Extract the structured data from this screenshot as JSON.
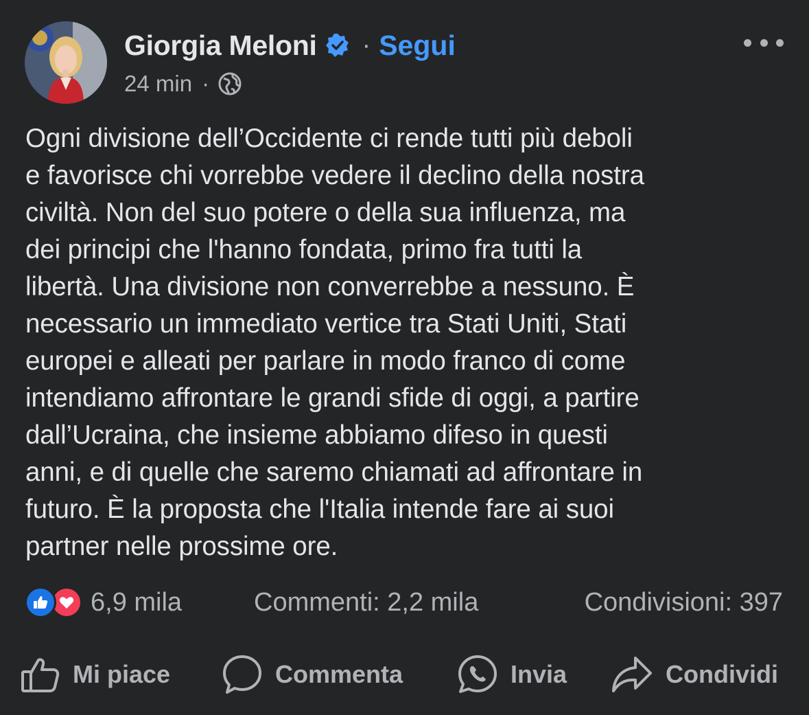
{
  "post": {
    "author": "Giorgia Meloni",
    "follow_label": "Segui",
    "separator": "·",
    "time": "24 min",
    "audience_icon": "globe-icon",
    "more_icon": "more-dots-icon",
    "text_lines": [
      "Ogni divisione dell’Occidente ci rende tutti più deboli",
      "e favorisce chi vorrebbe vedere il declino della nostra",
      "civiltà. Non del suo potere o della sua influenza, ma",
      "dei principi che l'hanno fondata, primo fra tutti la",
      "libertà. Una divisione non converrebbe a nessuno. È",
      "necessario un immediato vertice tra Stati Uniti, Stati",
      "europei e alleati per parlare in modo franco di come",
      "intendiamo affrontare le grandi sfide di oggi, a partire",
      "dall’Ucraina, che insieme abbiamo difeso in questi",
      "anni, e di quelle che saremo chiamati ad affrontare in",
      "futuro. È la proposta che l'Italia intende fare ai suoi",
      "partner nelle prossime ore."
    ]
  },
  "stats": {
    "reactions_count": "6,9 mila",
    "comments": "Commenti: 2,2 mila",
    "shares": "Condivisioni: 397"
  },
  "actions": {
    "like": "Mi piace",
    "comment": "Commenta",
    "send": "Invia",
    "share": "Condividi"
  },
  "colors": {
    "background": "#242526",
    "text_primary": "#e4e6eb",
    "text_secondary": "#b0b3b8",
    "link_blue": "#4599ff",
    "like_blue": "#1b74e4",
    "love_red": "#f33e58"
  }
}
